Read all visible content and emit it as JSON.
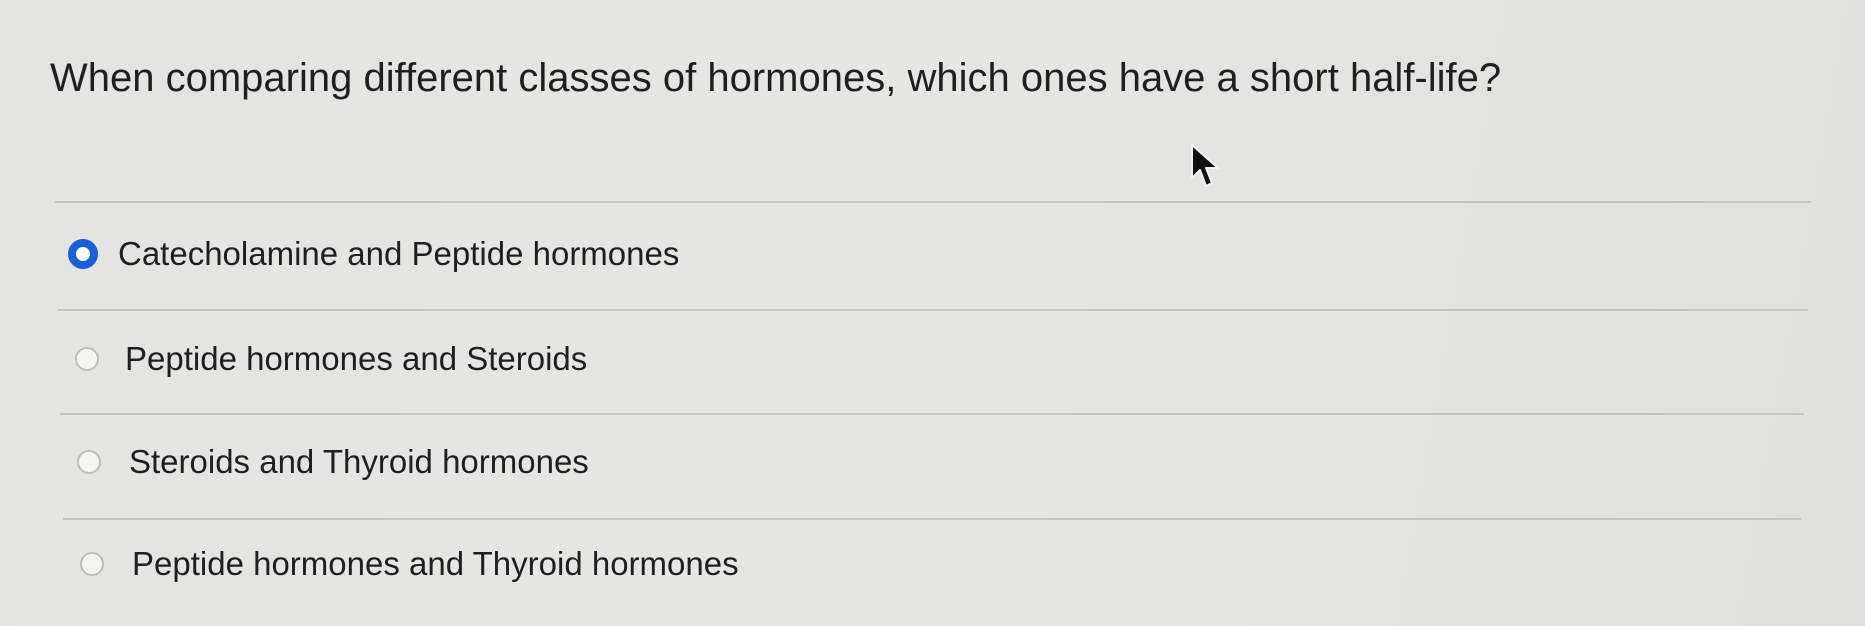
{
  "question": {
    "text": "When comparing different classes of hormones, which ones have a short half-life?"
  },
  "options": [
    {
      "label": "Catecholamine and Peptide hormones",
      "selected": true
    },
    {
      "label": "Peptide hormones and Steroids",
      "selected": false
    },
    {
      "label": "Steroids and Thyroid hormones",
      "selected": false
    },
    {
      "label": "Peptide hormones and Thyroid hormones",
      "selected": false
    }
  ],
  "cursor": {
    "icon": "mouse-pointer-icon"
  },
  "colors": {
    "accent": "#1a5fd6",
    "background": "#e4e4e2",
    "divider": "#c4c4c2",
    "text": "#1f1f1f"
  }
}
